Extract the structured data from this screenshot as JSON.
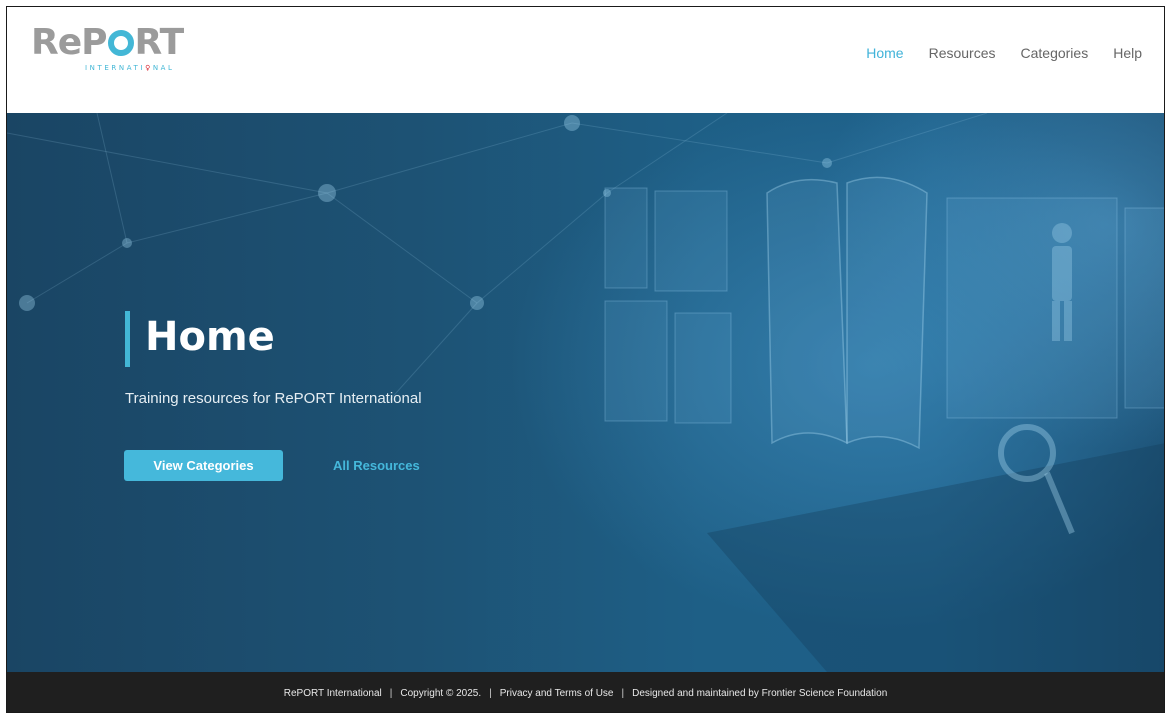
{
  "brand": {
    "logo_main_left": "ReP",
    "logo_main_right": "RT",
    "logo_sub_left": "INTERNATI",
    "logo_sub_ribbon": "♀",
    "logo_sub_right": "NAL"
  },
  "nav": {
    "items": [
      {
        "label": "Home",
        "active": true
      },
      {
        "label": "Resources",
        "active": false
      },
      {
        "label": "Categories",
        "active": false
      },
      {
        "label": "Help",
        "active": false
      }
    ]
  },
  "hero": {
    "title": "Home",
    "subtitle": "Training resources for RePORT International",
    "primary_button": "View Categories",
    "secondary_link": "All Resources"
  },
  "footer": {
    "org": "RePORT International",
    "copyright": "Copyright © 2025.",
    "privacy": "Privacy and Terms of Use",
    "maintained": "Designed and maintained by Frontier Science Foundation",
    "separator": "|"
  },
  "colors": {
    "accent": "#43b7d6",
    "nav_inactive": "#666666",
    "footer_bg": "#1f1f1f"
  }
}
